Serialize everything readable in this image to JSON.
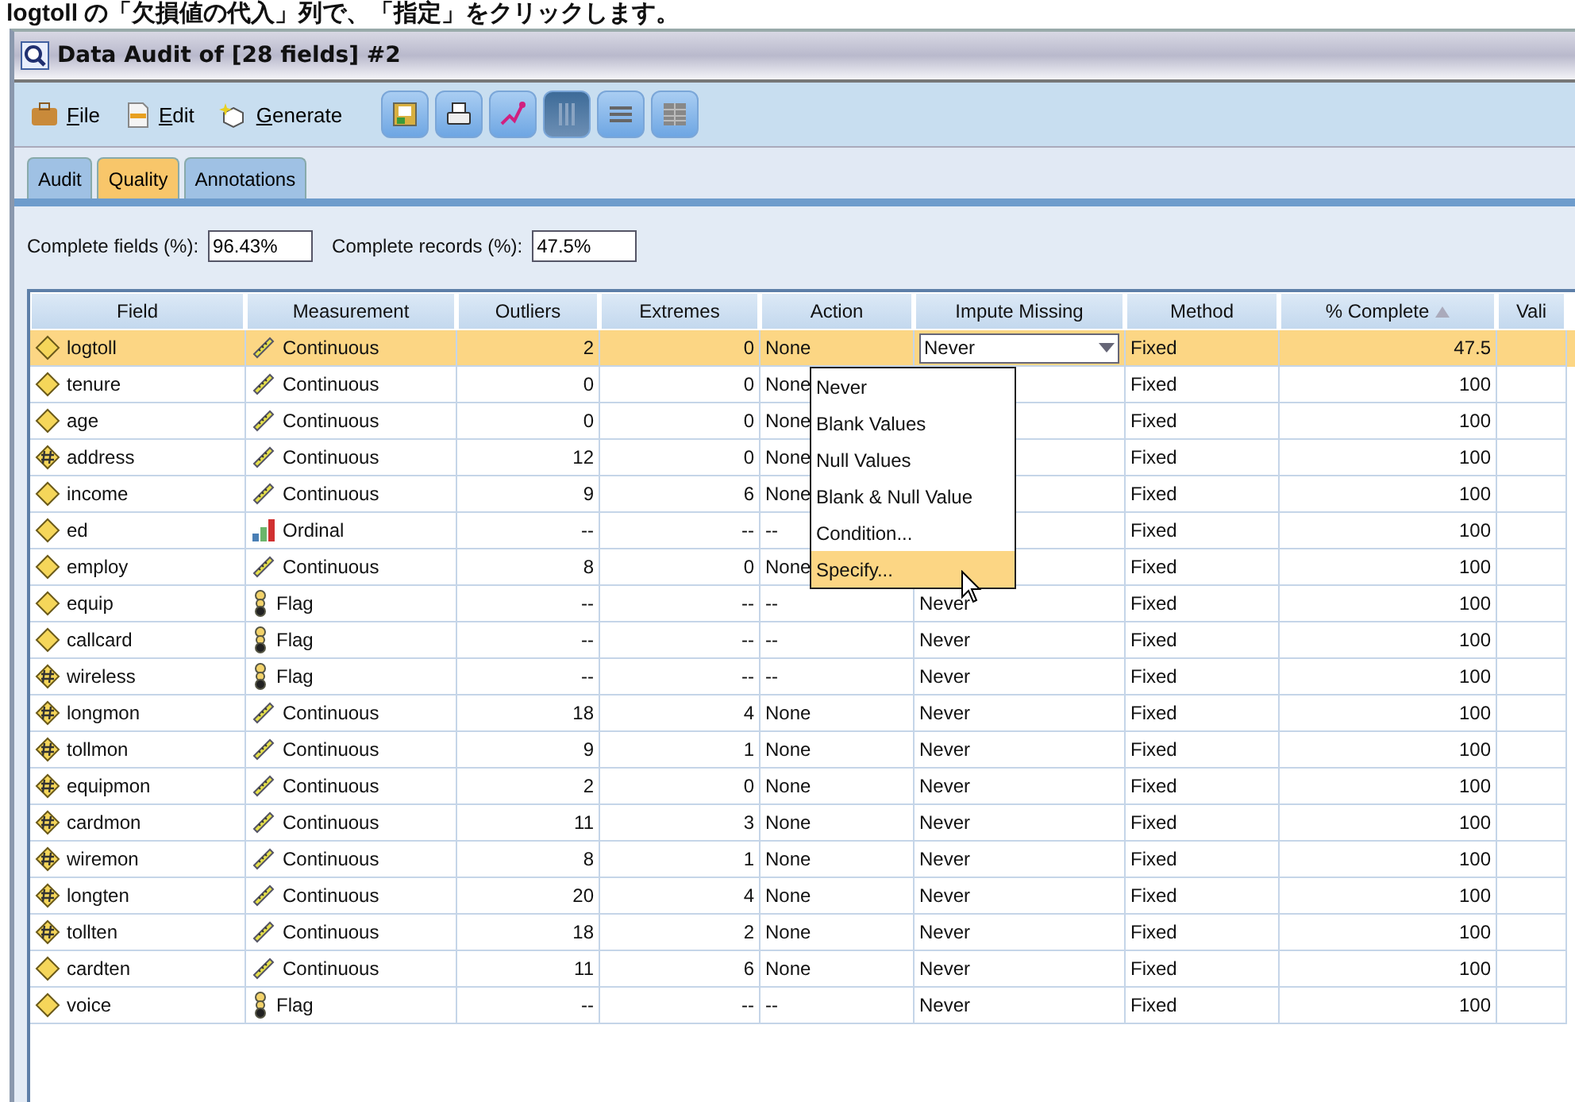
{
  "caption": "logtoll の「欠損値の代入」列で、「指定」をクリックします。",
  "window": {
    "title": "Data Audit of [28 fields] #2"
  },
  "menu": [
    {
      "label": "File",
      "kind": "file"
    },
    {
      "label": "Edit",
      "kind": "edit"
    },
    {
      "label": "Generate",
      "kind": "generate"
    }
  ],
  "toolbar_buttons": [
    {
      "kind": "export",
      "selected": false
    },
    {
      "kind": "print",
      "selected": false
    },
    {
      "kind": "chart",
      "selected": false
    },
    {
      "kind": "columns",
      "selected": true
    },
    {
      "kind": "lines",
      "selected": false
    },
    {
      "kind": "table",
      "selected": false
    }
  ],
  "tabs": [
    {
      "label": "Audit",
      "selected": false
    },
    {
      "label": "Quality",
      "selected": true
    },
    {
      "label": "Annotations",
      "selected": false
    }
  ],
  "summary": [
    {
      "label": "Complete fields (%):",
      "value": "96.43%"
    },
    {
      "label": "Complete records (%):",
      "value": "47.5%"
    }
  ],
  "table": {
    "columns": [
      {
        "label": "Field",
        "sorted": false
      },
      {
        "label": "Measurement",
        "sorted": false
      },
      {
        "label": "Outliers",
        "sorted": false
      },
      {
        "label": "Extremes",
        "sorted": false
      },
      {
        "label": "Action",
        "sorted": false
      },
      {
        "label": "Impute Missing",
        "sorted": false
      },
      {
        "label": "Method",
        "sorted": false
      },
      {
        "label": "% Complete",
        "sorted": true
      },
      {
        "label": "Vali",
        "sorted": false
      }
    ],
    "rows": [
      {
        "field": {
          "name": "logtoll",
          "kind": "plain"
        },
        "measurement": {
          "label": "Continuous",
          "kind": "continuous"
        },
        "outliers": "2",
        "extremes": "0",
        "action": "None",
        "impute": "Never",
        "method": "Fixed",
        "complete": "47.5",
        "selected": true
      },
      {
        "field": {
          "name": "tenure",
          "kind": "plain"
        },
        "measurement": {
          "label": "Continuous",
          "kind": "continuous"
        },
        "outliers": "0",
        "extremes": "0",
        "action": "None",
        "method": "Fixed",
        "complete": "100",
        "selected": false
      },
      {
        "field": {
          "name": "age",
          "kind": "plain"
        },
        "measurement": {
          "label": "Continuous",
          "kind": "continuous"
        },
        "outliers": "0",
        "extremes": "0",
        "action": "None",
        "method": "Fixed",
        "complete": "100",
        "selected": false
      },
      {
        "field": {
          "name": "address",
          "kind": "numeric"
        },
        "measurement": {
          "label": "Continuous",
          "kind": "continuous"
        },
        "outliers": "12",
        "extremes": "0",
        "action": "None",
        "method": "Fixed",
        "complete": "100",
        "selected": false
      },
      {
        "field": {
          "name": "income",
          "kind": "plain"
        },
        "measurement": {
          "label": "Continuous",
          "kind": "continuous"
        },
        "outliers": "9",
        "extremes": "6",
        "action": "None",
        "method": "Fixed",
        "complete": "100",
        "selected": false
      },
      {
        "field": {
          "name": "ed",
          "kind": "plain"
        },
        "measurement": {
          "label": "Ordinal",
          "kind": "ordinal"
        },
        "outliers": "--",
        "extremes": "--",
        "action": "--",
        "method": "Fixed",
        "complete": "100",
        "selected": false
      },
      {
        "field": {
          "name": "employ",
          "kind": "plain"
        },
        "measurement": {
          "label": "Continuous",
          "kind": "continuous"
        },
        "outliers": "8",
        "extremes": "0",
        "action": "None",
        "method": "Fixed",
        "complete": "100",
        "selected": false
      },
      {
        "field": {
          "name": "equip",
          "kind": "plain"
        },
        "measurement": {
          "label": "Flag",
          "kind": "flag"
        },
        "outliers": "--",
        "extremes": "--",
        "action": "--",
        "impute": "Never",
        "method": "Fixed",
        "complete": "100",
        "selected": false
      },
      {
        "field": {
          "name": "callcard",
          "kind": "plain"
        },
        "measurement": {
          "label": "Flag",
          "kind": "flag"
        },
        "outliers": "--",
        "extremes": "--",
        "action": "--",
        "impute": "Never",
        "method": "Fixed",
        "complete": "100",
        "selected": false
      },
      {
        "field": {
          "name": "wireless",
          "kind": "numeric"
        },
        "measurement": {
          "label": "Flag",
          "kind": "flag"
        },
        "outliers": "--",
        "extremes": "--",
        "action": "--",
        "impute": "Never",
        "method": "Fixed",
        "complete": "100",
        "selected": false
      },
      {
        "field": {
          "name": "longmon",
          "kind": "numeric"
        },
        "measurement": {
          "label": "Continuous",
          "kind": "continuous"
        },
        "outliers": "18",
        "extremes": "4",
        "action": "None",
        "impute": "Never",
        "method": "Fixed",
        "complete": "100",
        "selected": false
      },
      {
        "field": {
          "name": "tollmon",
          "kind": "numeric"
        },
        "measurement": {
          "label": "Continuous",
          "kind": "continuous"
        },
        "outliers": "9",
        "extremes": "1",
        "action": "None",
        "impute": "Never",
        "method": "Fixed",
        "complete": "100",
        "selected": false
      },
      {
        "field": {
          "name": "equipmon",
          "kind": "numeric"
        },
        "measurement": {
          "label": "Continuous",
          "kind": "continuous"
        },
        "outliers": "2",
        "extremes": "0",
        "action": "None",
        "impute": "Never",
        "method": "Fixed",
        "complete": "100",
        "selected": false
      },
      {
        "field": {
          "name": "cardmon",
          "kind": "numeric"
        },
        "measurement": {
          "label": "Continuous",
          "kind": "continuous"
        },
        "outliers": "11",
        "extremes": "3",
        "action": "None",
        "impute": "Never",
        "method": "Fixed",
        "complete": "100",
        "selected": false
      },
      {
        "field": {
          "name": "wiremon",
          "kind": "numeric"
        },
        "measurement": {
          "label": "Continuous",
          "kind": "continuous"
        },
        "outliers": "8",
        "extremes": "1",
        "action": "None",
        "impute": "Never",
        "method": "Fixed",
        "complete": "100",
        "selected": false
      },
      {
        "field": {
          "name": "longten",
          "kind": "numeric"
        },
        "measurement": {
          "label": "Continuous",
          "kind": "continuous"
        },
        "outliers": "20",
        "extremes": "4",
        "action": "None",
        "impute": "Never",
        "method": "Fixed",
        "complete": "100",
        "selected": false
      },
      {
        "field": {
          "name": "tollten",
          "kind": "numeric"
        },
        "measurement": {
          "label": "Continuous",
          "kind": "continuous"
        },
        "outliers": "18",
        "extremes": "2",
        "action": "None",
        "impute": "Never",
        "method": "Fixed",
        "complete": "100",
        "selected": false
      },
      {
        "field": {
          "name": "cardten",
          "kind": "plain"
        },
        "measurement": {
          "label": "Continuous",
          "kind": "continuous"
        },
        "outliers": "11",
        "extremes": "6",
        "action": "None",
        "impute": "Never",
        "method": "Fixed",
        "complete": "100",
        "selected": false
      },
      {
        "field": {
          "name": "voice",
          "kind": "plain"
        },
        "measurement": {
          "label": "Flag",
          "kind": "flag"
        },
        "outliers": "--",
        "extremes": "--",
        "action": "--",
        "impute": "Never",
        "method": "Fixed",
        "complete": "100",
        "selected": false
      }
    ]
  },
  "dropdown": {
    "options": [
      {
        "label": "Never",
        "selected": false
      },
      {
        "label": "Blank Values",
        "selected": false
      },
      {
        "label": "Null Values",
        "selected": false
      },
      {
        "label": "Blank & Null Value",
        "selected": false
      },
      {
        "label": "Condition...",
        "selected": false
      },
      {
        "label": "Specify...",
        "selected": true
      }
    ]
  }
}
